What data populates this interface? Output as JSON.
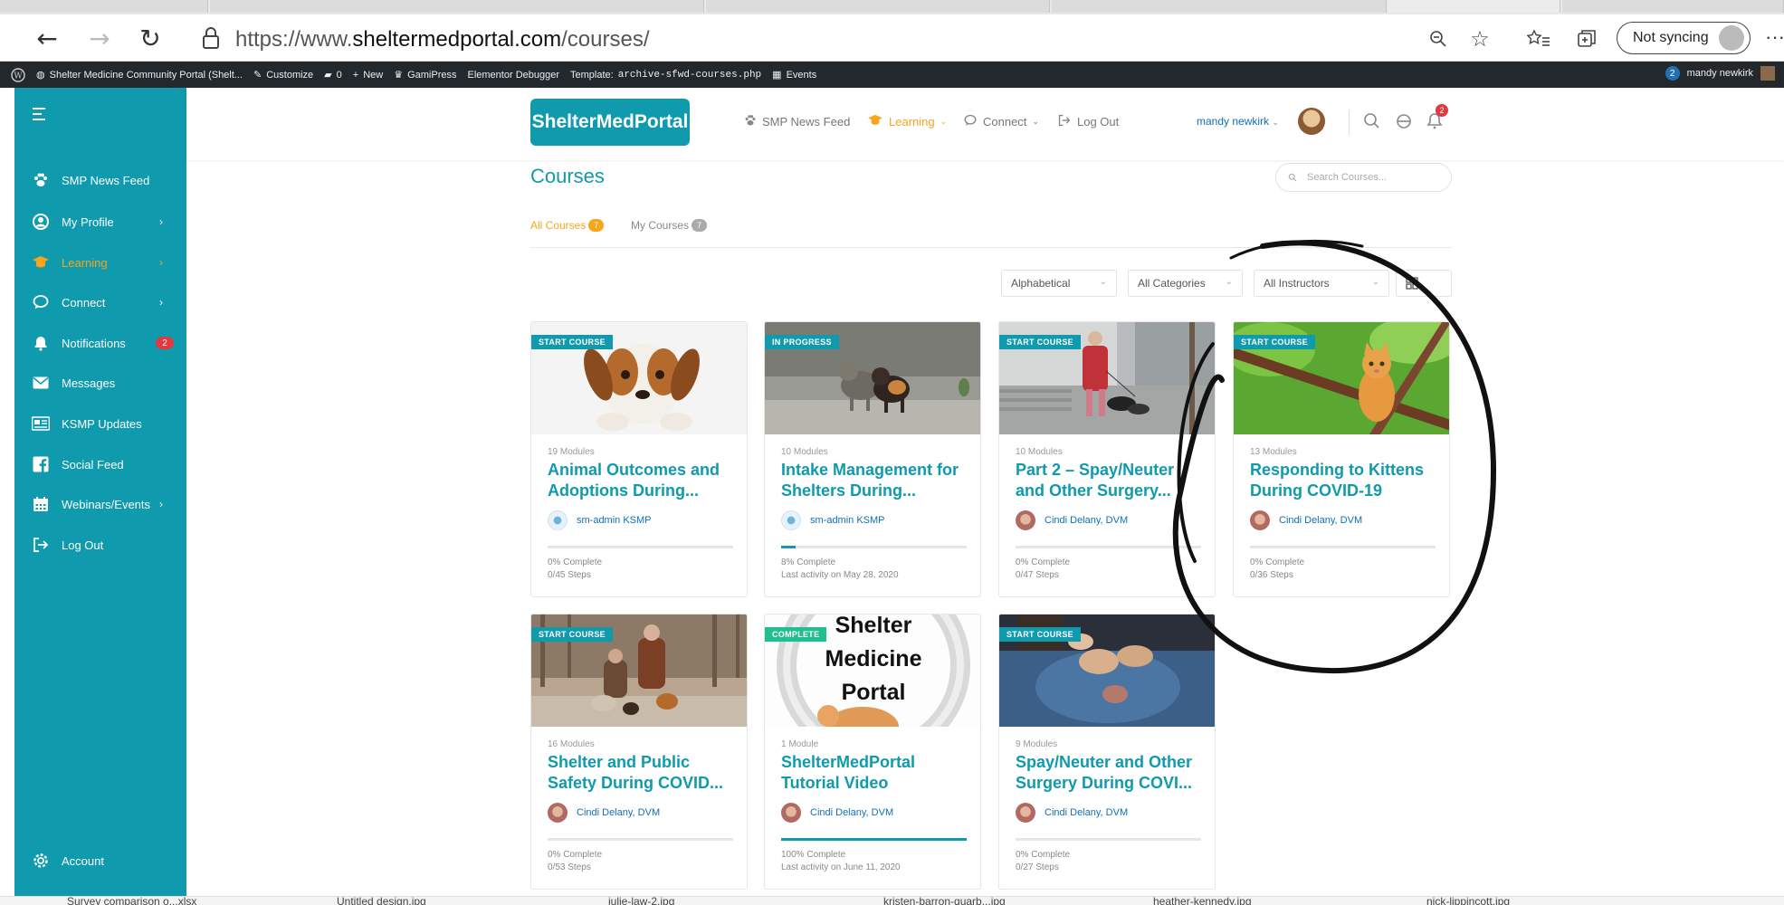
{
  "browser": {
    "url_scheme": "https://www.",
    "url_domain": "sheltermedportal.com",
    "url_path": "/courses/",
    "sync_label": "Not syncing",
    "more": "···"
  },
  "wpbar": {
    "site_name": "Shelter Medicine Community Portal (Shelt...",
    "customize": "Customize",
    "comments": "0",
    "new": "New",
    "gamipress": "GamiPress",
    "elementor": "Elementor Debugger",
    "template_label": "Template:",
    "template_file": "archive-sfwd-courses.php",
    "events": "Events",
    "user_badge": "2",
    "user_name": "mandy newkirk"
  },
  "sidebar": {
    "items": [
      {
        "label": "SMP News Feed",
        "icon": "paw-icon"
      },
      {
        "label": "My Profile",
        "icon": "profile-icon",
        "chevron": "›"
      },
      {
        "label": "Learning",
        "icon": "graduation-cap-icon",
        "chevron": "›"
      },
      {
        "label": "Connect",
        "icon": "chat-bubble-icon",
        "chevron": "›"
      },
      {
        "label": "Notifications",
        "icon": "bell-icon",
        "badge": "2"
      },
      {
        "label": "Messages",
        "icon": "envelope-icon"
      },
      {
        "label": "KSMP Updates",
        "icon": "newspaper-icon"
      },
      {
        "label": "Social Feed",
        "icon": "facebook-icon"
      },
      {
        "label": "Webinars/Events",
        "icon": "calendar-icon",
        "chevron": "›"
      },
      {
        "label": "Log Out",
        "icon": "logout-icon"
      }
    ],
    "account": "Account"
  },
  "header": {
    "logo": "ShelterMedPortal",
    "nav": {
      "news": "SMP News Feed",
      "learning": "Learning",
      "connect": "Connect",
      "logout": "Log Out"
    },
    "user": "mandy newkirk",
    "notif_count": "2"
  },
  "content": {
    "title": "Courses",
    "search_placeholder": "Search Courses...",
    "tabs": {
      "all": "All Courses",
      "all_count": "7",
      "mine": "My Courses",
      "mine_count": "7"
    },
    "filters": {
      "sort": "Alphabetical",
      "categories": "All Categories",
      "instructors": "All Instructors"
    }
  },
  "courses": [
    {
      "status": "START COURSE",
      "modules": "19 Modules",
      "title": "Animal Outcomes and Adoptions During...",
      "author": "sm-admin KSMP",
      "progress": 0,
      "complete": "0% Complete",
      "steps": "0/45 Steps"
    },
    {
      "status": "IN PROGRESS",
      "modules": "10 Modules",
      "title": "Intake Management for Shelters During...",
      "author": "sm-admin KSMP",
      "progress": 8,
      "complete": "8% Complete",
      "steps": "Last activity on May 28, 2020"
    },
    {
      "status": "START COURSE",
      "modules": "10 Modules",
      "title": "Part 2 – Spay/Neuter and Other Surgery...",
      "author": "Cindi Delany, DVM",
      "progress": 0,
      "complete": "0% Complete",
      "steps": "0/47 Steps"
    },
    {
      "status": "START COURSE",
      "modules": "13 Modules",
      "title": "Responding to Kittens During COVID-19",
      "author": "Cindi Delany, DVM",
      "progress": 0,
      "complete": "0% Complete",
      "steps": "0/36 Steps"
    },
    {
      "status": "START COURSE",
      "modules": "16 Modules",
      "title": "Shelter and Public Safety During COVID...",
      "author": "Cindi Delany, DVM",
      "progress": 0,
      "complete": "0% Complete",
      "steps": "0/53 Steps"
    },
    {
      "status": "COMPLETE",
      "modules": "1 Module",
      "title": "ShelterMedPortal Tutorial Video",
      "author": "Cindi Delany, DVM",
      "progress": 100,
      "complete": "100% Complete",
      "steps": "Last activity on June 11, 2020",
      "image_text": [
        "Shelter",
        "Medicine",
        "Portal"
      ]
    },
    {
      "status": "START COURSE",
      "modules": "9 Modules",
      "title": "Spay/Neuter and Other Surgery During COVI...",
      "author": "Cindi Delany, DVM",
      "progress": 0,
      "complete": "0% Complete",
      "steps": "0/27 Steps"
    }
  ],
  "taskbar": {
    "items": [
      "Survey comparison o...xlsx",
      "Untitled design.jpg",
      "julie-law-2.jpg",
      "kristen-barron-quarb...jpg",
      "heather-kennedy.jpg",
      "nick-lippincott.jpg"
    ]
  },
  "colors": {
    "brand": "#0f9aae",
    "accent": "#f7a51d",
    "badge": "#e0393e",
    "complete": "#1fbf8f"
  }
}
